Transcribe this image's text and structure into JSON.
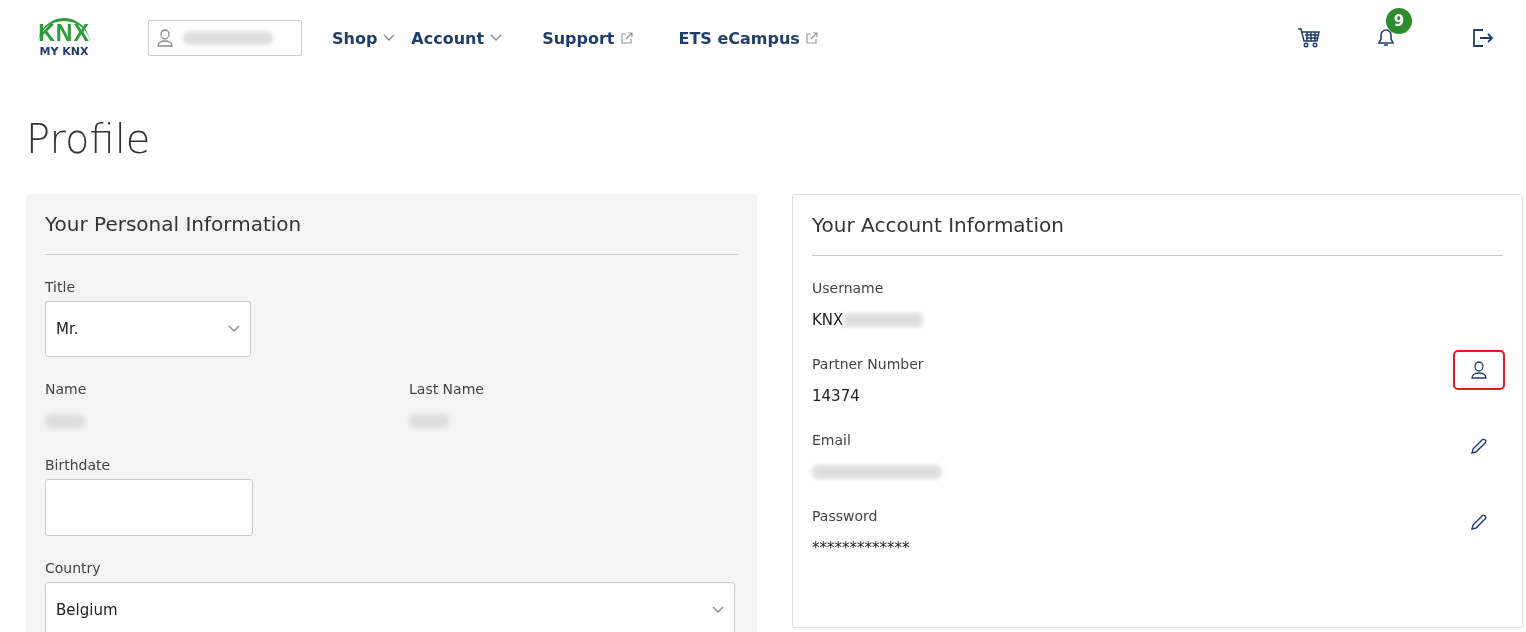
{
  "header": {
    "logo": {
      "mark": "KNX",
      "subtitle": "MY KNX"
    },
    "user_menu": {
      "redacted": true
    },
    "nav": [
      {
        "label": "Shop",
        "kind": "dropdown"
      },
      {
        "label": "Account",
        "kind": "dropdown"
      },
      {
        "label": "Support",
        "kind": "external"
      },
      {
        "label": "ETS eCampus",
        "kind": "external"
      }
    ],
    "actions": [
      {
        "kind": "cart"
      },
      {
        "kind": "bell",
        "badge": "9"
      },
      {
        "kind": "logout"
      }
    ]
  },
  "page_title": "Profile",
  "personal": {
    "title": "Your Personal Information",
    "fields": [
      {
        "kind": "select",
        "label": "Title",
        "value": "Mr."
      },
      {
        "kind": "pair",
        "items": [
          {
            "label": "Name",
            "redacted": true
          },
          {
            "label": "Last Name",
            "redacted": true
          }
        ]
      },
      {
        "kind": "input",
        "label": "Birthdate"
      },
      {
        "kind": "select-wide",
        "label": "Country",
        "value": "Belgium"
      }
    ]
  },
  "account": {
    "title": "Your Account Information",
    "rows": [
      {
        "kind": "plain",
        "label": "Username",
        "value": "KNX",
        "redacted": true
      },
      {
        "kind": "partner",
        "label": "Partner Number",
        "value": "14374",
        "highlighted": true
      },
      {
        "kind": "edit",
        "label": "Email",
        "redacted": true,
        "highlighted": false
      },
      {
        "kind": "edit",
        "label": "Password",
        "value": "*************",
        "highlighted": false
      }
    ]
  }
}
